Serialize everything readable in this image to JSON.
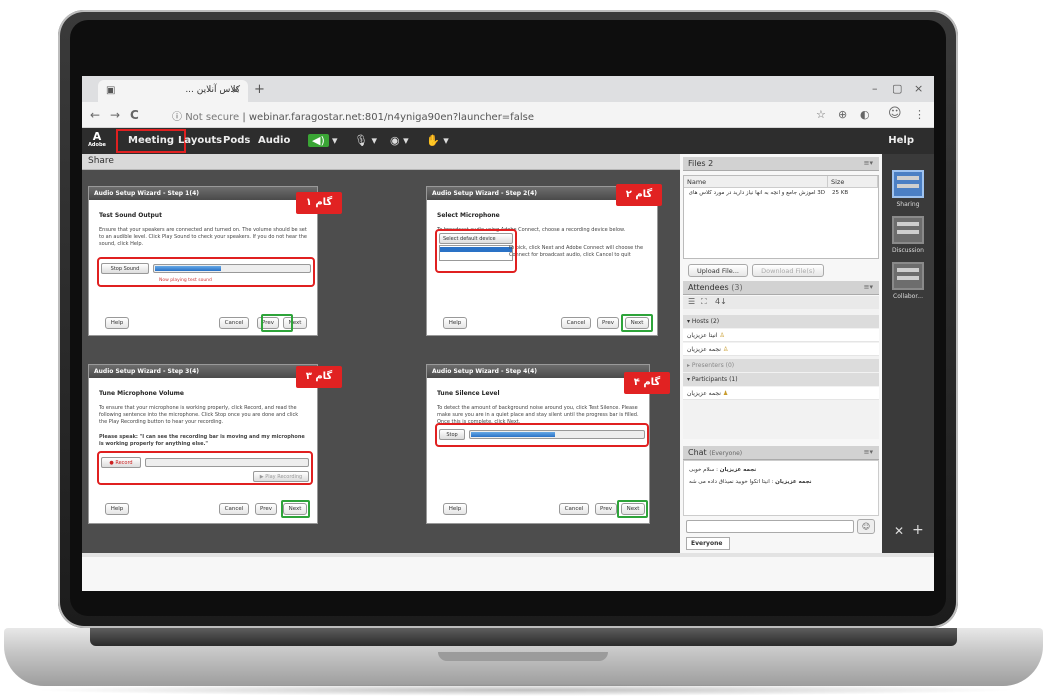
{
  "browser": {
    "tab_title": "کلاس آنلاین ...",
    "tab_close": "×",
    "new_tab": "+",
    "win_min": "–",
    "win_max": "▢",
    "win_close": "×",
    "back": "←",
    "forward": "→",
    "reload": "C",
    "not_secure": "Not secure",
    "url": "webinar.faragostar.net:801/n4yniga90en?launcher=false"
  },
  "toolbar": {
    "adobe_label": "Adobe",
    "menus": [
      "Meeting",
      "Layouts",
      "Pods",
      "Audio"
    ],
    "help": "Help"
  },
  "share": {
    "title": "Share",
    "steps": [
      {
        "badge": "گام ۱",
        "title": "Audio Setup Wizard - Step 1(4)",
        "subtitle": "Test Sound Output",
        "text": "Ensure that your speakers are connected and turned on. The volume should be set to an audible level. Click Play Sound to check your speakers. If you do not hear the sound, click Help.",
        "control": "Stop Sound",
        "note": "Now playing test sound",
        "progress": 0.42,
        "help": "Help",
        "cancel": "Cancel",
        "prev": "Prev",
        "next": "Next"
      },
      {
        "badge": "گام ۲",
        "title": "Audio Setup Wizard - Step 2(4)",
        "subtitle": "Select Microphone",
        "text": "To broadcast audio using Adobe Connect, choose a recording device below.",
        "control": "Select default device",
        "text2": "to pick, click Next and Adobe Connect will choose the Connect for broadcast audio, click Cancel to quit",
        "help": "Help",
        "cancel": "Cancel",
        "prev": "Prev",
        "next": "Next"
      },
      {
        "badge": "گام ۳",
        "title": "Audio Setup Wizard - Step 3(4)",
        "subtitle": "Tune Microphone Volume",
        "text": "To ensure that your microphone is working properly, click Record, and read the following sentence into the microphone. Click Stop once you are done and click the Play Recording button to hear your recording.",
        "text2": "Please speak: \"I can see the recording bar is moving and my microphone is working properly for anything else.\"",
        "control": "Record",
        "control2": "Play Recording",
        "help": "Help",
        "cancel": "Cancel",
        "prev": "Prev",
        "next": "Next"
      },
      {
        "badge": "گام ۴",
        "title": "Audio Setup Wizard - Step 4(4)",
        "subtitle": "Tune Silence Level",
        "text": "To detect the amount of background noise around you, click Test Silence. Please make sure you are in a quiet place and stay silent until the progress bar is filled. Once this is complete, click Next.",
        "control": "Stop",
        "progress": 0.48,
        "help": "Help",
        "cancel": "Cancel",
        "prev": "Prev",
        "next": "Next"
      }
    ]
  },
  "files": {
    "title": "Files 2",
    "col_name": "Name",
    "col_size": "Size",
    "row_name": "3D آموزش جامع و آنچه به آنها نیاز دارید در مورد کلاس های آنلاین",
    "row_size": "25 KB",
    "upload": "Upload File...",
    "download": "Download File(s)"
  },
  "attendees": {
    "title": "Attendees",
    "count": "(3)",
    "hosts_label": "Hosts (2)",
    "hosts": [
      "انیتا عزیزیان",
      "نجمه عزیزیان"
    ],
    "presenters_label": "Presenters (0)",
    "participants_label": "Participants (1)",
    "participants": [
      "نجمه عزیزیان"
    ]
  },
  "chat": {
    "title": "Chat",
    "scope": "(Everyone)",
    "messages": [
      {
        "author": "نجمه عزیزیان",
        "text": "سلام خوبی"
      },
      {
        "author": "نجمه عزیزیان",
        "text": "انیتا اتکوا خوبید نمیذاق داده می شه"
      }
    ],
    "send": "☺",
    "tab": "Everyone"
  },
  "layouts": {
    "items": [
      "Sharing",
      "Discussion",
      "Collabor..."
    ]
  },
  "colors": {
    "accent_red": "#e12222",
    "accent_green": "#2ea43a",
    "progress_blue": "#2a72c6"
  }
}
